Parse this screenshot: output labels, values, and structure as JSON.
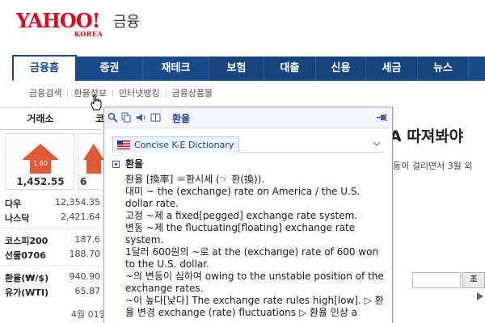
{
  "header": {
    "logo_main": "YAHOO!",
    "logo_sub": "KOREA",
    "site_title": "금융"
  },
  "nav": {
    "items": [
      {
        "label": "금융홈",
        "active": true
      },
      {
        "label": "증권",
        "active": false
      },
      {
        "label": "재테크",
        "active": false
      },
      {
        "label": "보험",
        "active": false
      },
      {
        "label": "대출",
        "active": false
      },
      {
        "label": "신용",
        "active": false
      },
      {
        "label": "세금",
        "active": false
      },
      {
        "label": "뉴스",
        "active": false
      }
    ]
  },
  "subnav": {
    "items": [
      "금융검색",
      "환율정보",
      "인터넷뱅킹",
      "금융상품몰"
    ]
  },
  "ticker": {
    "tab_forex": "거래소",
    "tab_second": "코",
    "card1_change": "1.60",
    "card1_value": "1,452.55",
    "card2_value": "6",
    "rows": [
      {
        "label": "다우",
        "value": "12,354.35"
      },
      {
        "label": "나스닥",
        "value": "2,421.64"
      },
      {
        "label": "코스피200",
        "value": "187.6"
      },
      {
        "label": "선물0706",
        "value": "188.70"
      },
      {
        "label": "환율(₩/$)",
        "value": "940.90"
      },
      {
        "label": "유가(WTI)",
        "value": "65.87"
      }
    ],
    "date_note": "4월 01일"
  },
  "background": {
    "headline": "A 따져봐야",
    "snippet": "동이 걸리면서 3월 외",
    "search_button": "조"
  },
  "popup": {
    "word": "환율",
    "dictionary": "Concise K-E Dictionary",
    "headword": "환율",
    "lines": [
      "환율 [換率] ＝환시세 (☞ 환(換)).",
      "대미 ~ the (exchange) rate on America / the U.S. dollar rate.",
      "고정 ~제 a fixed[pegged] exchange rate system.",
      "변동 ~제 the fluctuating[floating] exchange rate system.",
      "1달러 600원의 ~로 at the (exchange) rate of 600 won to the U.S. dollar.",
      "~의 변동이 심하여 owing to the unstable position of the exchange rates.",
      "~이 높다[낮다] The exchange rate rules high[low]. ▷ 환율 변경 exchange (rate) fluctuations ▷ 환율 인상 a"
    ]
  },
  "colors": {
    "nav_blue": "#1a4a8a",
    "brand_red": "#e2001a",
    "arrow_red": "#e25a35",
    "popup_border": "#8fa6c8",
    "link_blue": "#1d3f8f"
  },
  "icons": [
    "magnifier-icon",
    "copy-icon",
    "speaker-icon",
    "book-icon",
    "pin-icon",
    "us-flag-icon",
    "chevron-down-icon",
    "hand-cursor-icon",
    "up-arrow-icon"
  ]
}
